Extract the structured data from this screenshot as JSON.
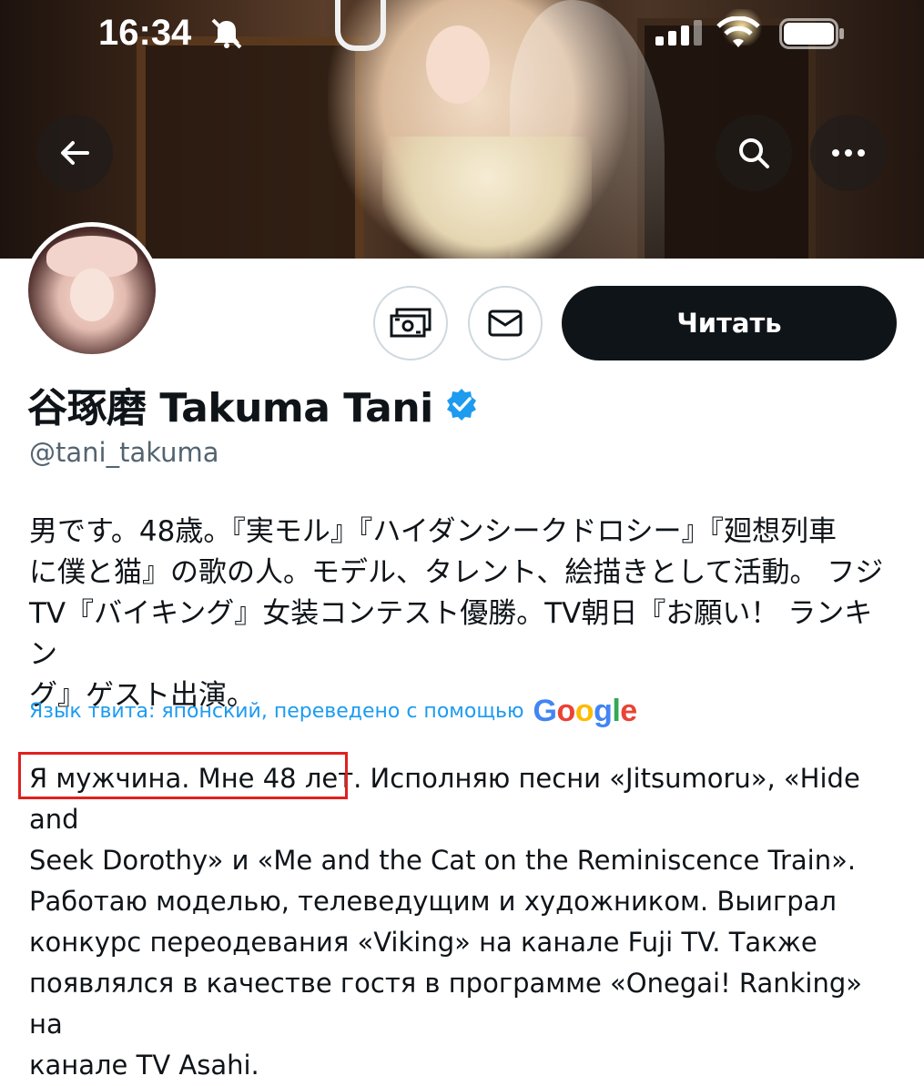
{
  "status_bar": {
    "time": "16:34",
    "icons": [
      "bell-slash-icon",
      "cellular-signal-icon",
      "wifi-icon",
      "battery-icon"
    ]
  },
  "nav": {
    "back_icon": "arrow-left-icon",
    "search_icon": "search-icon",
    "more_icon": "more-horizontal-icon"
  },
  "actions": {
    "tip_icon": "money-icon",
    "dm_icon": "mail-icon",
    "follow_label": "Читать"
  },
  "profile": {
    "display_name": "谷琢磨 Takuma Tani",
    "handle": "@tani_takuma",
    "verified": true,
    "verified_color": "#1d9bf0",
    "bio_original": "男です。48歳。『実モル』『ハイダンシークドロシー』『廻想列車\nに僕と猫』の歌の人。モデル、タレント、絵描きとして活動。 フジ\nTV『バイキング』女装コンテスト優勝。TV朝日『お願い！ ランキン\nグ』ゲスト出演。",
    "translation_label": "Язык твита: японский, переведено с помощью",
    "translation_provider": "Google",
    "bio_translated_highlight": "Я мужчина. Мне 48 лет.",
    "bio_translated_rest": " Исполняю песни «Jitsumoru», «Hide and\nSeek Dorothy» и «Me and the Cat on the Reminiscence Train».\nРаботаю моделью, телеведущим и художником. Выиграл\nконкурс переодевания «Viking» на канале Fuji TV. Также\nпоявлялся в качестве гостя в программе «Onegai! Ranking» на\nканале TV Asahi."
  },
  "colors": {
    "follow_bg": "#0f1419",
    "highlight_border": "#e0201d",
    "link": "#1d9bf0",
    "secondary_text": "#536471"
  }
}
